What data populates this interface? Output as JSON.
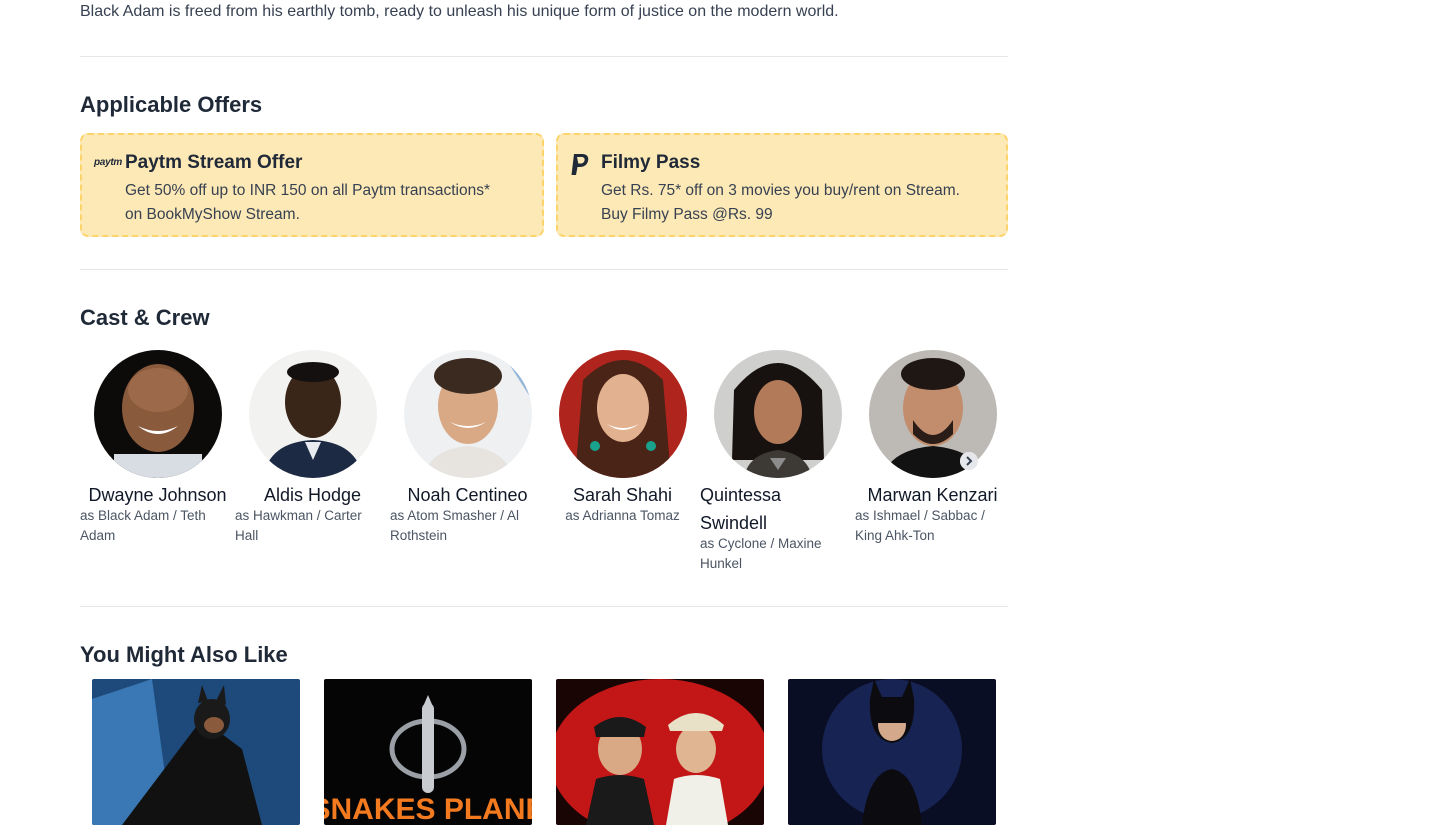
{
  "synopsis": "Black Adam is freed from his earthly tomb, ready to unleash his unique form of justice on the modern world.",
  "offers": {
    "title": "Applicable Offers",
    "items": [
      {
        "logo": "paytm",
        "title": "Paytm Stream Offer",
        "line1": "Get 50% off up to INR 150 on all Paytm transactions*",
        "line2": "on BookMyShow Stream."
      },
      {
        "logo": "paypal-icon",
        "title": "Filmy Pass",
        "line1": "Get Rs. 75* off on 3 movies you buy/rent on Stream.",
        "line2": "Buy Filmy Pass @Rs. 99"
      }
    ]
  },
  "cast": {
    "title": "Cast & Crew",
    "members": [
      {
        "name": "Dwayne Johnson",
        "role_line1": "as Black Adam / Teth",
        "role_line2": "Adam"
      },
      {
        "name": "Aldis Hodge",
        "role_line1": "as Hawkman / Carter",
        "role_line2": "Hall"
      },
      {
        "name": "Noah Centineo",
        "role_line1": "as Atom Smasher / Al",
        "role_line2": "Rothstein"
      },
      {
        "name": "Sarah Shahi",
        "role_line1": "as Adrianna Tomaz",
        "role_line2": ""
      },
      {
        "name_line1": "Quintessa",
        "name_line2": "Swindell",
        "role_line1": "as Cyclone / Maxine",
        "role_line2": "Hunkel"
      },
      {
        "name": "Marwan Kenzari",
        "role_line1": "as Ishmael / Sabbac /",
        "role_line2": "King Ahk-Ton"
      }
    ]
  },
  "recommendations": {
    "title": "You Might Also Like",
    "posters": [
      {
        "poster_text": ""
      },
      {
        "poster_text": "SNAKES PLANE"
      },
      {
        "poster_text": ""
      },
      {
        "poster_text": ""
      }
    ]
  },
  "colors": {
    "offer_bg": "#fde9b6",
    "offer_border": "#fbd46b",
    "heading": "#1f2937"
  }
}
